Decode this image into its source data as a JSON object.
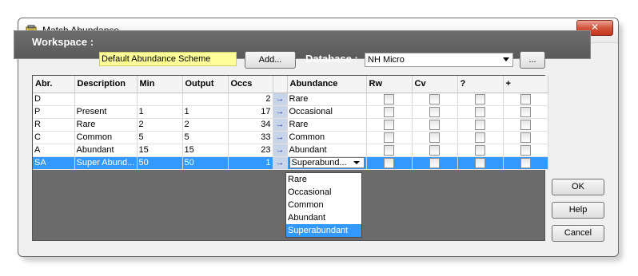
{
  "window": {
    "title": "Match Abundance",
    "close_label": "✕"
  },
  "toolbar": {
    "workspace_label": "Workspace :",
    "workspace_value": "Default Abundance Scheme",
    "add_label": "Add...",
    "database_label": "Database :",
    "database_value": "NH Micro",
    "browse_label": "..."
  },
  "grid": {
    "headers": [
      "Abr.",
      "Description",
      "Min",
      "Output",
      "Occs",
      "",
      "Abundance",
      "Rw",
      "Cv",
      "?",
      "+"
    ],
    "rows": [
      {
        "abr": "D",
        "description": "",
        "min": "",
        "output": "",
        "occs": "2",
        "arrow": "→",
        "abundance": "Rare"
      },
      {
        "abr": "P",
        "description": "Present",
        "min": "1",
        "output": "1",
        "occs": "17",
        "arrow": "→",
        "abundance": "Occasional"
      },
      {
        "abr": "R",
        "description": "Rare",
        "min": "2",
        "output": "2",
        "occs": "34",
        "arrow": "→",
        "abundance": "Rare"
      },
      {
        "abr": "C",
        "description": "Common",
        "min": "5",
        "output": "5",
        "occs": "33",
        "arrow": "→",
        "abundance": "Common"
      },
      {
        "abr": "A",
        "description": "Abundant",
        "min": "15",
        "output": "15",
        "occs": "23",
        "arrow": "→",
        "abundance": "Abundant"
      },
      {
        "abr": "SA",
        "description": "Super Abund...",
        "min": "50",
        "output": "50",
        "occs": "1",
        "arrow": "→",
        "abundance": "Superabund..."
      }
    ]
  },
  "dropdown": {
    "options": [
      "Rare",
      "Occasional",
      "Common",
      "Abundant",
      "Superabundant"
    ],
    "selected": "Superabundant"
  },
  "buttons": {
    "ok": "OK",
    "help": "Help",
    "cancel": "Cancel"
  },
  "colors": {
    "selection": "#3399ff",
    "workspace_field": "#ffff99",
    "toolbar": "#646464",
    "close": "#c7432b"
  }
}
